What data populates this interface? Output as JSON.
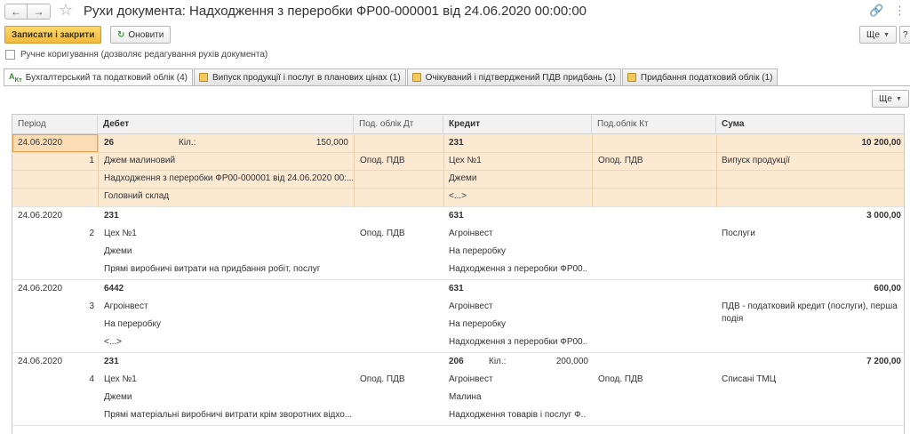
{
  "window": {
    "title": "Рухи документа: Надходження з переробки ФР00-000001 від 24.06.2020 00:00:00",
    "back_icon": "arrow-left-icon",
    "forward_icon": "arrow-right-icon",
    "link_icon": "link-icon",
    "menu_icon": "more-vertical-icon"
  },
  "toolbar": {
    "save_close": "Записати і закрити",
    "refresh": "Оновити",
    "more": "Ще",
    "help": "?"
  },
  "manual_edit": {
    "label": "Ручне коригування (дозволяє редагування рухів документа)",
    "checked": false
  },
  "tabs": [
    {
      "label": "Бухгалтерський та податковий облік (4)",
      "active": true
    },
    {
      "label": "Випуск продукції і послуг в планових цінах (1)",
      "active": false
    },
    {
      "label": "Очікуваний і підтверджений ПДВ придбань (1)",
      "active": false
    },
    {
      "label": "Придбання податковий облік (1)",
      "active": false
    }
  ],
  "grid_more": "Ще",
  "columns": {
    "period": "Період",
    "debit": "Дебет",
    "tax_dt": "Под. облік Дт",
    "credit": "Кредит",
    "tax_kt": "Под.облік Кт",
    "sum": "Сума"
  },
  "entries": [
    {
      "date": "24.06.2020",
      "num": "1",
      "debit_acc": "26",
      "debit_qty_label": "Кіл.:",
      "debit_qty": "150,000",
      "debit_sub": [
        "Джем малиновий",
        "Надходження з переробки ФР00-000001 від 24.06.2020 00:...",
        "Головний склад"
      ],
      "tax_dt": "Опод. ПДВ",
      "credit_acc": "231",
      "credit_qty_label": "",
      "credit_qty": "",
      "credit_sub": [
        "Цех №1",
        "Джеми",
        "<...>"
      ],
      "tax_kt": "Опод. ПДВ",
      "sum": "10 200,00",
      "content": "Випуск продукції",
      "content2": ""
    },
    {
      "date": "24.06.2020",
      "num": "2",
      "debit_acc": "231",
      "debit_qty_label": "",
      "debit_qty": "",
      "debit_sub": [
        "Цех №1",
        "Джеми",
        "Прямі виробничі витрати на придбання робіт, послуг"
      ],
      "tax_dt": "Опод. ПДВ",
      "credit_acc": "631",
      "credit_qty_label": "",
      "credit_qty": "",
      "credit_sub": [
        "Агроінвест",
        "На переробку",
        "Надходження з переробки ФР00..."
      ],
      "tax_kt": "",
      "sum": "3 000,00",
      "content": "Послуги",
      "content2": ""
    },
    {
      "date": "24.06.2020",
      "num": "3",
      "debit_acc": "6442",
      "debit_qty_label": "",
      "debit_qty": "",
      "debit_sub": [
        "Агроінвест",
        "На переробку",
        "<...>"
      ],
      "tax_dt": "",
      "credit_acc": "631",
      "credit_qty_label": "",
      "credit_qty": "",
      "credit_sub": [
        "Агроінвест",
        "На переробку",
        "Надходження з переробки ФР00..."
      ],
      "tax_kt": "",
      "sum": "600,00",
      "content": "ПДВ - податковий кредит (послуги), перша",
      "content2": "подія"
    },
    {
      "date": "24.06.2020",
      "num": "4",
      "debit_acc": "231",
      "debit_qty_label": "",
      "debit_qty": "",
      "debit_sub": [
        "Цех №1",
        "Джеми",
        "Прямі матеріальні виробничі витрати крім зворотних відхо..."
      ],
      "tax_dt": "Опод. ПДВ",
      "credit_acc": "206",
      "credit_qty_label": "Кіл.:",
      "credit_qty": "200,000",
      "credit_sub": [
        "Агроінвест",
        "Малина",
        "Надходження товарів і послуг Ф..."
      ],
      "tax_kt": "Опод. ПДВ",
      "sum": "7 200,00",
      "content": "Списані ТМЦ",
      "content2": ""
    }
  ]
}
